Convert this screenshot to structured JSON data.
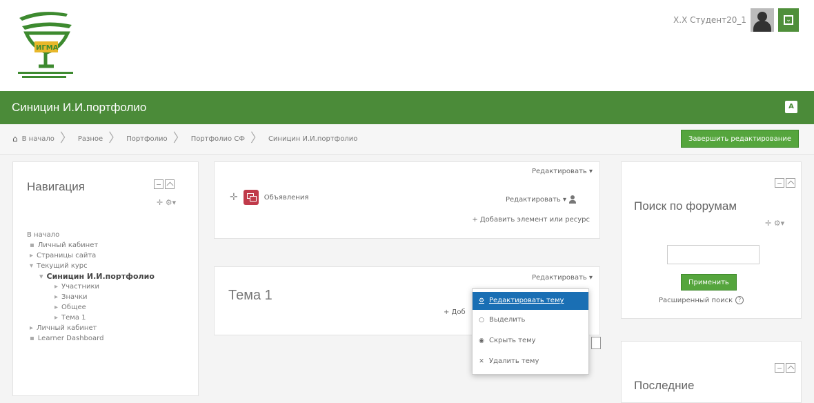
{
  "user": {
    "name": "Х.Х Студент20_1"
  },
  "header": {
    "course_title": "Синицин И.И.портфолио"
  },
  "breadcrumbs": [
    "В начало",
    "Разное",
    "Портфолио",
    "Портфолио СФ",
    "Синицин И.И.портфолио"
  ],
  "finish_editing": "Завершить редактирование",
  "navigation": {
    "title": "Навигация",
    "items": [
      {
        "label": "В начало",
        "mark": ""
      },
      {
        "label": "Личный кабинет",
        "mark": "▪"
      },
      {
        "label": "Страницы сайта",
        "mark": "▸"
      },
      {
        "label": "Текущий курс",
        "mark": "▾"
      },
      {
        "label": "Синицин И.И.портфолио",
        "mark": "▾"
      },
      {
        "label": "Участники",
        "mark": "▸"
      },
      {
        "label": "Значки",
        "mark": "▸"
      },
      {
        "label": "Общее",
        "mark": "▸"
      },
      {
        "label": "Тема 1",
        "mark": "▸"
      },
      {
        "label": "Личный кабинет",
        "mark": "▸"
      },
      {
        "label": "Learner Dashboard",
        "mark": "▪"
      }
    ]
  },
  "section0": {
    "edit": "Редактировать ▾",
    "activity": "Объявления",
    "activity_edit": "Редактировать ▾",
    "add": "+ Добавить элемент или ресурс"
  },
  "section1": {
    "edit": "Редактировать ▾",
    "title": "Тема 1",
    "add": "+ Доб"
  },
  "dropdown": [
    {
      "label": "Редактировать тему",
      "icon": "⚙"
    },
    {
      "label": "Выделить",
      "icon": "○"
    },
    {
      "label": "Скрыть тему",
      "icon": "◉"
    },
    {
      "label": "Удалить тему",
      "icon": "✕"
    }
  ],
  "search_forums": {
    "title": "Поиск по форумам",
    "apply": "Применить",
    "advanced": "Расширенный поиск"
  },
  "latest": {
    "title": "Последние"
  },
  "colors": {
    "brand_green": "#4b8b39",
    "button_green": "#55a53d",
    "active_blue": "#1a6fb4"
  }
}
